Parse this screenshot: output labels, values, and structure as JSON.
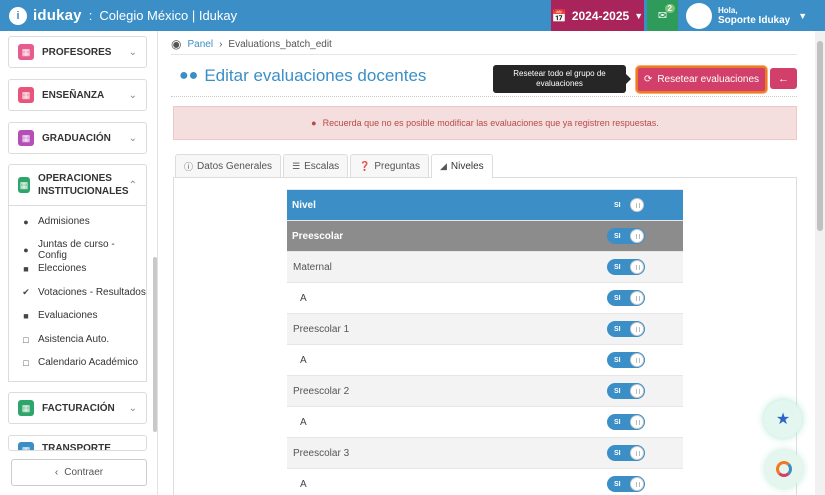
{
  "app": {
    "brand": "idukay",
    "school": "Colegio México | Idukay"
  },
  "topbar": {
    "year": "2024-2025",
    "messages_badge": "2",
    "user_greeting": "Hola,",
    "user_name": "Soporte Idukay"
  },
  "sidebar": {
    "sections": [
      {
        "label": "PROFESORES",
        "color": "#e85b8e",
        "icon": "id-card-icon"
      },
      {
        "label": "ENSEÑANZA",
        "color": "#e8557a",
        "icon": "book-icon"
      },
      {
        "label": "GRADUACIÓN",
        "color": "#b44fb8",
        "icon": "graduation-icon"
      },
      {
        "label": "OPERACIONES INSTITUCIONALES",
        "color": "#2ea56a",
        "icon": "building-icon"
      }
    ],
    "sub_items": [
      {
        "label": "Admisiones",
        "icon": "user-plus-icon"
      },
      {
        "label": "Juntas de curso - Config",
        "icon": "users-icon"
      },
      {
        "label": "Elecciones",
        "icon": "archive-icon"
      },
      {
        "label": "Votaciones - Resultados",
        "icon": "check-circle-icon"
      },
      {
        "label": "Evaluaciones",
        "icon": "clipboard-icon"
      },
      {
        "label": "Asistencia Auto.",
        "icon": "calendar-check-icon"
      },
      {
        "label": "Calendario Académico",
        "icon": "calendar-icon"
      }
    ],
    "lower_sections": [
      {
        "label": "FACTURACIÓN",
        "color": "#2ea56a"
      },
      {
        "label": "TRANSPORTE",
        "color": "#3b8fc6"
      }
    ],
    "collapse_label": "Contraer"
  },
  "breadcrumb": {
    "root": "Panel",
    "current": "Evaluations_batch_edit"
  },
  "page": {
    "title": "Editar evaluaciones docentes",
    "tooltip": "Resetear todo el grupo de evaluaciones",
    "reset_label": "Resetear evaluaciones",
    "alert": "Recuerda que no es posible modificar las evaluaciones que ya registren respuestas."
  },
  "tabs": [
    {
      "label": "Datos Generales",
      "icon": "info-icon",
      "active": false
    },
    {
      "label": "Escalas",
      "icon": "list-icon",
      "active": false
    },
    {
      "label": "Preguntas",
      "icon": "question-icon",
      "active": false
    },
    {
      "label": "Niveles",
      "icon": "sitemap-icon",
      "active": true
    }
  ],
  "levels_table": {
    "toggle_text": "SI",
    "rows": [
      {
        "label": "Nivel",
        "kind": "head"
      },
      {
        "label": "Preescolar",
        "kind": "grp"
      },
      {
        "label": "Maternal",
        "kind": "sub1"
      },
      {
        "label": "A",
        "kind": "leaf"
      },
      {
        "label": "Preescolar 1",
        "kind": "sub1"
      },
      {
        "label": "A",
        "kind": "leaf"
      },
      {
        "label": "Preescolar 2",
        "kind": "sub1"
      },
      {
        "label": "A",
        "kind": "leaf"
      },
      {
        "label": "Preescolar 3",
        "kind": "sub1"
      },
      {
        "label": "A",
        "kind": "leaf"
      }
    ]
  }
}
